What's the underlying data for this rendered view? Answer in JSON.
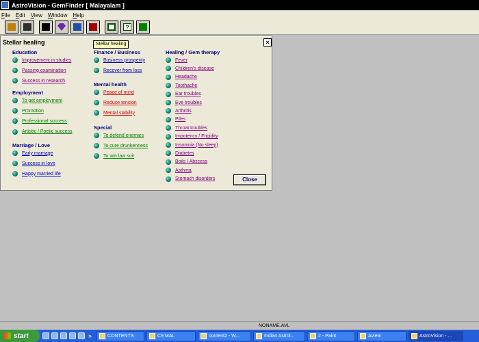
{
  "window": {
    "title": "AstroVision - GemFinder [ Malayalam ]"
  },
  "menu": [
    "File",
    "Edit",
    "View",
    "Window",
    "Help"
  ],
  "toolbar": {
    "buttons": [
      {
        "icon": "open-folder-icon",
        "color": "#c08000"
      },
      {
        "icon": "save-icon",
        "color": "#303030"
      },
      {
        "icon": "person-icon",
        "color": "#000000"
      },
      {
        "icon": "gem-icon",
        "color": "#6a2ca8"
      },
      {
        "icon": "people-icon",
        "color": "#2050a0"
      },
      {
        "icon": "monitor-gem-icon",
        "color": "#a00000"
      },
      {
        "icon": "document-icon",
        "color": "#005000"
      },
      {
        "icon": "help-icon",
        "color": "#005000"
      },
      {
        "icon": "exit-icon",
        "color": "#008000"
      }
    ]
  },
  "panel": {
    "title": "Stellar healing",
    "tooltip": "Stellar healing",
    "close_x": "×",
    "columns": [
      {
        "groups": [
          {
            "heading": "Education",
            "items": [
              {
                "label": "Improvement in studies",
                "color": "#800080"
              },
              {
                "label": "Passing examination",
                "color": "#800080"
              },
              {
                "label": "Success in research",
                "color": "#800080"
              }
            ]
          },
          {
            "heading": "Employment",
            "items": [
              {
                "label": "To get employment",
                "color": "#008000"
              },
              {
                "label": "Promotion",
                "color": "#008000"
              },
              {
                "label": "Professional success",
                "color": "#008000"
              },
              {
                "label": "Artistic / Poetic success",
                "color": "#008000"
              }
            ]
          },
          {
            "heading": "Marriage / Love",
            "items": [
              {
                "label": "Early marriage",
                "color": "#0000c0"
              },
              {
                "label": "Success in love",
                "color": "#0000c0"
              },
              {
                "label": "Happy married life",
                "color": "#0000c0"
              }
            ]
          }
        ]
      },
      {
        "groups": [
          {
            "heading": "Finance / Business",
            "items": [
              {
                "label": "Business prosperity",
                "color": "#0000c0"
              },
              {
                "label": "Recover from loss",
                "color": "#0000c0"
              }
            ]
          },
          {
            "heading": "Mental health",
            "items": [
              {
                "label": "Peace of mind",
                "color": "#e00000"
              },
              {
                "label": "Reduce tension",
                "color": "#e00000"
              },
              {
                "label": "Mental stability",
                "color": "#e00000"
              }
            ]
          },
          {
            "heading": "Special",
            "items": [
              {
                "label": "To defend enemies",
                "color": "#008000"
              },
              {
                "label": "To cure drunkenness",
                "color": "#008000"
              },
              {
                "label": "To win law suit",
                "color": "#008000"
              }
            ]
          }
        ]
      },
      {
        "groups": [
          {
            "heading": "Healing / Gem therapy",
            "items": [
              {
                "label": "Fever",
                "color": "#800080"
              },
              {
                "label": "Children's disease",
                "color": "#800080"
              },
              {
                "label": "Headache",
                "color": "#800080"
              },
              {
                "label": "Toothache",
                "color": "#800080"
              },
              {
                "label": "Ear troubles",
                "color": "#800080"
              },
              {
                "label": "Eye troubles",
                "color": "#800080"
              },
              {
                "label": "Arthritis",
                "color": "#800080"
              },
              {
                "label": "Piles",
                "color": "#800080"
              },
              {
                "label": "Throat troubles",
                "color": "#800080"
              },
              {
                "label": "Impotency / Frigidity",
                "color": "#800080"
              },
              {
                "label": "Insomnia (No sleep)",
                "color": "#800080"
              },
              {
                "label": "Diabetes",
                "color": "#800080"
              },
              {
                "label": "Boils / Abscess",
                "color": "#800080"
              },
              {
                "label": "Asthma",
                "color": "#800080"
              },
              {
                "label": "Stomach disorders",
                "color": "#800080"
              }
            ]
          }
        ]
      }
    ],
    "close_button": "Close"
  },
  "statusbar": {
    "filename": "NONAME.AVL"
  },
  "taskbar": {
    "start": "start",
    "chevron": "»",
    "tasks": [
      {
        "label": "CONTENTS"
      },
      {
        "label": "C9 MAL"
      },
      {
        "label": "content2 - W..."
      },
      {
        "label": "Indian Astrol..."
      },
      {
        "label": "2 - Paint"
      },
      {
        "label": "Aview"
      },
      {
        "label": "AstroVision - ..."
      }
    ]
  }
}
